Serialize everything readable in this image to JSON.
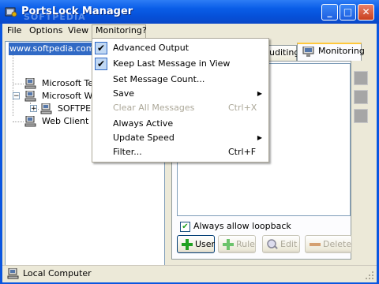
{
  "window": {
    "title": "PortsLock Manager",
    "watermark": "SOFTPEDIA",
    "minimize_glyph": "_",
    "maximize_glyph": "□",
    "close_glyph": "✕"
  },
  "menubar": {
    "items": [
      "File",
      "Options",
      "View",
      "Monitoring",
      "?"
    ]
  },
  "tree": {
    "items": [
      {
        "label": "www.softpedia.com",
        "selected": true
      },
      {
        "label": "Microsoft Terr"
      },
      {
        "label": "Microsoft Wind"
      },
      {
        "label": "SOFTPEDIA"
      },
      {
        "label": "Web Client Ne"
      }
    ]
  },
  "tabs": [
    {
      "label": "uditing"
    },
    {
      "label": "Monitoring",
      "selected": true
    }
  ],
  "panel": {
    "loopback_label": "Always allow loopback",
    "loopback_checked": true,
    "buttons": [
      {
        "label": "User",
        "icon": "plus-icon",
        "enabled": true
      },
      {
        "label": "Rule",
        "icon": "plus-icon",
        "enabled": false
      },
      {
        "label": "Edit",
        "icon": "magnifier-icon",
        "enabled": false
      },
      {
        "label": "Delete",
        "icon": "minus-icon",
        "enabled": false
      }
    ]
  },
  "monitoring_menu": {
    "items": [
      {
        "label": "Advanced Output",
        "checked": true
      },
      {
        "label": "Keep Last Message in View",
        "checked": true
      },
      {
        "label": "Set Message Count..."
      },
      {
        "label": "Save",
        "submenu": true
      },
      {
        "label": "Clear All Messages",
        "shortcut": "Ctrl+X",
        "disabled": true
      },
      {
        "label": "Always Active"
      },
      {
        "label": "Update Speed",
        "submenu": true
      },
      {
        "label": "Filter...",
        "shortcut": "Ctrl+F"
      }
    ]
  },
  "status": {
    "text": "Local Computer"
  },
  "colors": {
    "title_blue": "#0a56e0",
    "selection_blue": "#316ac5",
    "tab_highlight": "#ffc83c",
    "plus_green": "#21a121"
  }
}
